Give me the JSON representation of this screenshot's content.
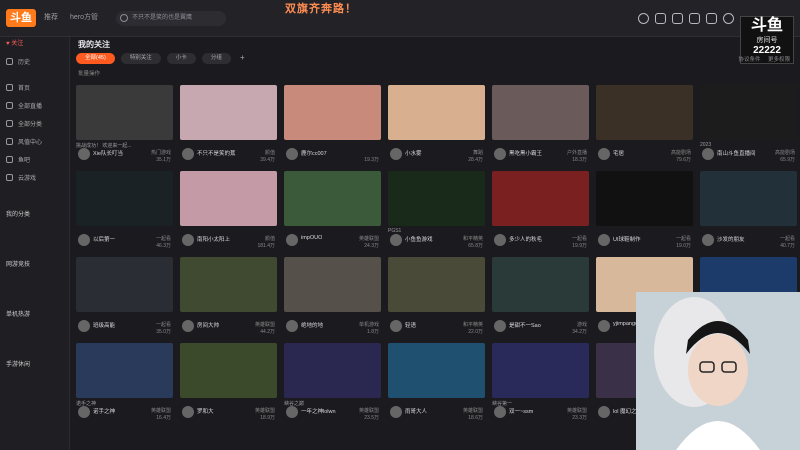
{
  "topbar": {
    "logo": "斗鱼",
    "nav": [
      "推荐",
      "hero方管",
      "",
      "不只不是笑的也是翼鹰"
    ],
    "banner": "双旗齐奔路！",
    "room_tag": {
      "big": "斗鱼",
      "label": "房间号",
      "number": "22222"
    },
    "right_links": [
      "协议条件",
      "更多权限"
    ]
  },
  "sidebar": {
    "follow_label": "关注",
    "items": [
      "历史",
      "首页",
      "全部直播",
      "全部分类",
      "风值中心",
      "鱼吧",
      "云游戏"
    ],
    "sections": [
      "我的分类",
      "网游竞技",
      "单机热游",
      "手游休闲"
    ]
  },
  "main": {
    "title": "我的关注",
    "tabs": [
      "全部(45)",
      "特别关注",
      "小卡",
      "分组"
    ],
    "batch": "批量操作",
    "colors": {
      "accent": "#ff5a1f"
    }
  },
  "cards": [
    {
      "name": "Xie队长叮当",
      "cat": "热门游戏",
      "views": "35.1万",
      "title": "挑战成功！ 欢迎来一起...",
      "bg": "#3a3a3a"
    },
    {
      "name": "不只不是笑的蕉",
      "cat": "颜值",
      "views": "39.4万",
      "title": "",
      "bg": "#c8a8b0"
    },
    {
      "name": "鹿尔cc007",
      "cat": "",
      "views": "19.3万",
      "title": "",
      "bg": "#c88a7a"
    },
    {
      "name": "小水雾",
      "cat": "舞蹈",
      "views": "28.4万",
      "title": "",
      "bg": "#d8b090"
    },
    {
      "name": "黑吃黑小霸王",
      "cat": "户外直播",
      "views": "18.3万",
      "title": "",
      "bg": "#6a5a5a"
    },
    {
      "name": "宅居",
      "cat": "高能剧场",
      "views": "79.6万",
      "title": "",
      "bg": "#3b3025"
    },
    {
      "name": "南山斗鱼直播间",
      "cat": "高能剧场",
      "views": "65.9万",
      "title": "2023",
      "bg": "#1c1c1c"
    },
    {
      "name": "以后第一",
      "cat": "一起看",
      "views": "46.3万",
      "title": "",
      "bg": "#1a2226"
    },
    {
      "name": "南阳小太阳上",
      "cat": "颜值",
      "views": "181.4万",
      "title": "",
      "bg": "#c39aa6"
    },
    {
      "name": "impOUO",
      "cat": "英雄联盟",
      "views": "24.3万",
      "title": "",
      "bg": "#3a5a3a"
    },
    {
      "name": "小鱼鱼游戏",
      "cat": "和平精英",
      "views": "65.8万",
      "title": "PGS1",
      "bg": "#1a2a1a"
    },
    {
      "name": "多少人的秋毛",
      "cat": "一起看",
      "views": "19.9万",
      "title": "",
      "bg": "#7a2020"
    },
    {
      "name": "UI球鞋制作",
      "cat": "一起看",
      "views": "19.0万",
      "title": "",
      "bg": "#111111"
    },
    {
      "name": "沙发的朋友",
      "cat": "一起看",
      "views": "40.7万",
      "title": "",
      "bg": "#22303a"
    },
    {
      "name": "班级高能",
      "cat": "一起看",
      "views": "35.0万",
      "title": "",
      "bg": "#2a2e34"
    },
    {
      "name": "房间大帅",
      "cat": "英雄联盟",
      "views": "44.2万",
      "title": "",
      "bg": "#3f4a30"
    },
    {
      "name": "绝地的地",
      "cat": "单机游戏",
      "views": "1.8万",
      "title": "",
      "bg": "#55504a"
    },
    {
      "name": "轻语",
      "cat": "和平精英",
      "views": "22.0万",
      "title": "",
      "bg": "#4a4a38"
    },
    {
      "name": "是甜不一Sao",
      "cat": "游戏",
      "views": "34.2万",
      "title": "",
      "bg": "#2a3a38"
    },
    {
      "name": "yjimpango",
      "cat": "颜值",
      "views": "27.1万",
      "title": "",
      "bg": "#d8b89a"
    },
    {
      "name": "至尊大哥",
      "cat": "",
      "views": "",
      "title": "至尊天团",
      "bg": "#1c3a6a"
    },
    {
      "name": "诺手之神",
      "cat": "英雄联盟",
      "views": "16.4万",
      "title": "诺手之神",
      "bg": "#2a3a5a"
    },
    {
      "name": "罗和大",
      "cat": "英雄联盟",
      "views": "18.9万",
      "title": "",
      "bg": "#3a4a2a"
    },
    {
      "name": "一年之神lolwn",
      "cat": "英雄联盟",
      "views": "23.5万",
      "title": "峡谷之巅",
      "bg": "#2a2850"
    },
    {
      "name": "雨哥大人",
      "cat": "英雄联盟",
      "views": "18.6万",
      "title": "",
      "bg": "#205070"
    },
    {
      "name": "双一~ssm",
      "cat": "英雄联盟",
      "views": "23.3万",
      "title": "峡谷第一",
      "bg": "#2a2a5a"
    },
    {
      "name": "lol 魔幻之神",
      "cat": "英雄联盟",
      "views": "26.0万",
      "title": "",
      "bg": "#3a3048"
    }
  ]
}
